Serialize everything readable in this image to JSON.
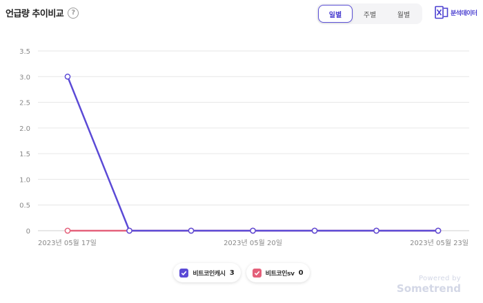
{
  "header": {
    "title": "언급량 추이비교",
    "help_icon": "question-circle-icon",
    "period_tabs": [
      {
        "label": "일별",
        "active": true
      },
      {
        "label": "주별",
        "active": false
      },
      {
        "label": "월별",
        "active": false
      }
    ],
    "export_label": "분석데이터",
    "export_icon": "excel-icon"
  },
  "chart_data": {
    "type": "line",
    "x": [
      "2023년 05월 17일",
      "2023년 05월 18일",
      "2023년 05월 19일",
      "2023년 05월 20일",
      "2023년 05월 21일",
      "2023년 05월 22일",
      "2023년 05월 23일"
    ],
    "x_tick_labels": [
      "2023년 05월 17일",
      "2023년 05월 20일",
      "2023년 05월 23일"
    ],
    "x_tick_index": [
      0,
      3,
      6
    ],
    "y_ticks": [
      "0",
      "0.5",
      "1.0",
      "1.5",
      "2.0",
      "2.5",
      "3.0",
      "3.5"
    ],
    "ylim": [
      0,
      3.5
    ],
    "grid": true,
    "series": [
      {
        "name": "비트코인캐시",
        "values": [
          3,
          0,
          0,
          0,
          0,
          0,
          0
        ],
        "color": "#5b4ad6"
      },
      {
        "name": "비트코인sv",
        "values": [
          0,
          0,
          0,
          0,
          0,
          0,
          0
        ],
        "color": "#e4607a"
      }
    ]
  },
  "legend": [
    {
      "name": "비트코인캐시",
      "value": "3",
      "color": "#5b4ad6"
    },
    {
      "name": "비트코인sv",
      "value": "0",
      "color": "#e4607a"
    }
  ],
  "footer": {
    "powered_by": "Powered by",
    "brand": "Sometrend"
  }
}
